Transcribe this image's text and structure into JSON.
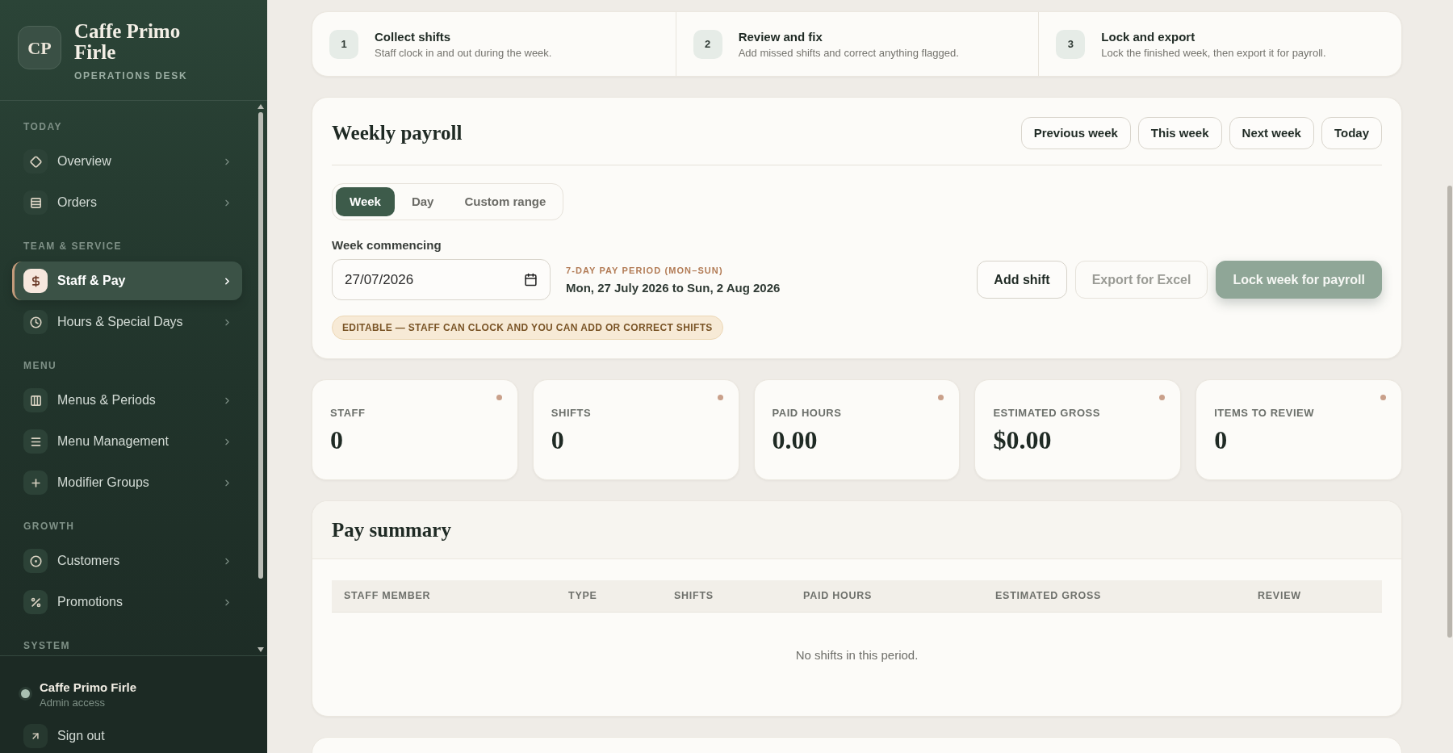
{
  "sidebar": {
    "brand": {
      "initials": "CP",
      "name": "Caffe Primo Firle",
      "subtitle": "OPERATIONS DESK"
    },
    "sections": [
      {
        "label": "TODAY",
        "items": [
          {
            "label": "Overview",
            "selected": false
          },
          {
            "label": "Orders",
            "selected": false
          }
        ]
      },
      {
        "label": "TEAM & SERVICE",
        "items": [
          {
            "label": "Staff & Pay",
            "selected": true
          },
          {
            "label": "Hours & Special Days",
            "selected": false
          }
        ]
      },
      {
        "label": "MENU",
        "items": [
          {
            "label": "Menus & Periods",
            "selected": false
          },
          {
            "label": "Menu Management",
            "selected": false
          },
          {
            "label": "Modifier Groups",
            "selected": false
          }
        ]
      },
      {
        "label": "GROWTH",
        "items": [
          {
            "label": "Customers",
            "selected": false
          },
          {
            "label": "Promotions",
            "selected": false
          }
        ]
      },
      {
        "label": "SYSTEM"
      }
    ],
    "account": {
      "name": "Caffe Primo Firle",
      "role": "Admin access"
    },
    "sign_out": "Sign out"
  },
  "steps": [
    {
      "number": "1",
      "title": "Collect shifts",
      "description": "Staff clock in and out during the week."
    },
    {
      "number": "2",
      "title": "Review and fix",
      "description": "Add missed shifts and correct anything flagged."
    },
    {
      "number": "3",
      "title": "Lock and export",
      "description": "Lock the finished week, then export it for payroll."
    }
  ],
  "payroll": {
    "title": "Weekly payroll",
    "nav_buttons": [
      "Previous week",
      "This week",
      "Next week",
      "Today"
    ],
    "range_tabs": [
      {
        "label": "Week",
        "selected": true
      },
      {
        "label": "Day",
        "selected": false
      },
      {
        "label": "Custom range",
        "selected": false
      }
    ],
    "week_field": {
      "label": "Week commencing",
      "value": "27/07/2026"
    },
    "period": {
      "caption": "7-DAY PAY PERIOD (MON–SUN)",
      "range": "Mon, 27 July 2026 to Sun, 2 Aug 2026"
    },
    "actions": [
      {
        "label": "Add shift",
        "kind": "secondary",
        "disabled": false
      },
      {
        "label": "Export for Excel",
        "kind": "secondary",
        "disabled": true
      },
      {
        "label": "Lock week for payroll",
        "kind": "primary",
        "disabled": true
      }
    ],
    "status_badge": "EDITABLE — STAFF CAN CLOCK AND YOU CAN ADD OR CORRECT SHIFTS"
  },
  "stats": [
    {
      "label": "STAFF",
      "value": "0"
    },
    {
      "label": "SHIFTS",
      "value": "0"
    },
    {
      "label": "PAID HOURS",
      "value": "0.00"
    },
    {
      "label": "ESTIMATED GROSS",
      "value": "$0.00"
    },
    {
      "label": "ITEMS TO REVIEW",
      "value": "0"
    }
  ],
  "pay_summary": {
    "title": "Pay summary",
    "columns": [
      "STAFF MEMBER",
      "TYPE",
      "SHIFTS",
      "PAID HOURS",
      "ESTIMATED GROSS",
      "REVIEW"
    ],
    "empty_text": "No shifts in this period."
  }
}
